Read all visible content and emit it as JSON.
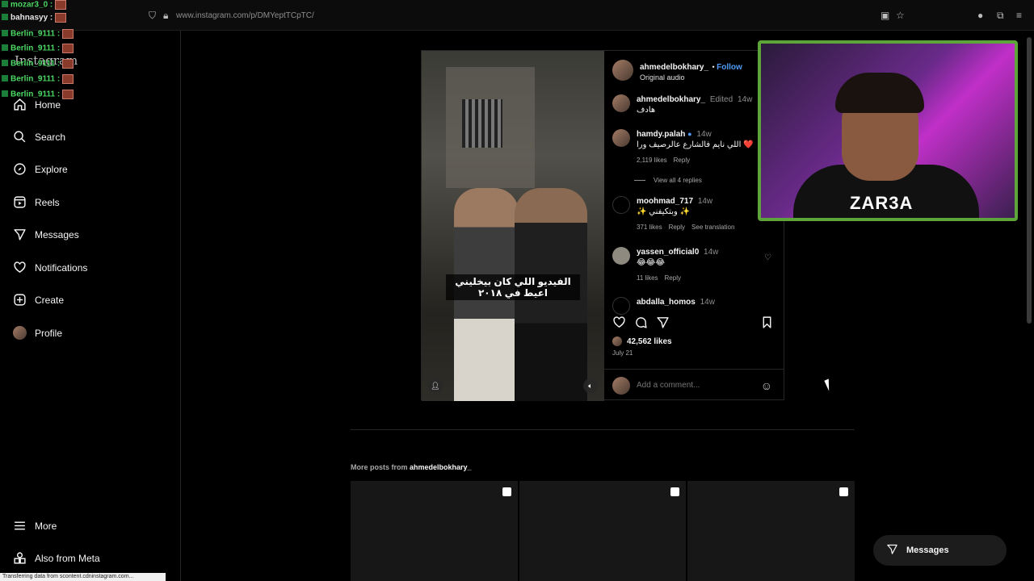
{
  "browser": {
    "url": "www.instagram.com/p/DMYeptTCpTC/"
  },
  "chat": [
    {
      "user": "mozar3_0 :"
    },
    {
      "user": "bahnasyy :"
    },
    {
      "user": "Berlin_9111 :"
    },
    {
      "user": "Berlin_9111 :"
    },
    {
      "user": "Berlin_9111 :"
    },
    {
      "user": "Berlin_9111 :"
    },
    {
      "user": "Berlin_9111 :"
    }
  ],
  "sidebar": {
    "logo": "Instagram",
    "items": [
      {
        "label": "Home",
        "icon": "home-icon"
      },
      {
        "label": "Search",
        "icon": "search-icon"
      },
      {
        "label": "Explore",
        "icon": "compass-icon"
      },
      {
        "label": "Reels",
        "icon": "reels-icon"
      },
      {
        "label": "Messages",
        "icon": "send-icon"
      },
      {
        "label": "Notifications",
        "icon": "heart-icon"
      },
      {
        "label": "Create",
        "icon": "plus-icon"
      },
      {
        "label": "Profile",
        "icon": "avatar"
      }
    ],
    "more": "More",
    "meta": "Also from Meta"
  },
  "status_bar": "Transferring data from scontent.cdninstagram.com...",
  "post": {
    "caption": "الفيديو اللي كان بيخليني اعيط في ٢٠١٨",
    "author": "ahmedelbokhary_",
    "follow": "Follow",
    "audio": "Original audio",
    "comments": [
      {
        "user": "ahmedelbokhary_",
        "badge": "Edited",
        "time": "14w",
        "text": "هادف"
      },
      {
        "user": "hamdy.palah",
        "time": "14w",
        "text": "❤️ اللي نايم فالشارع عالرصيف ورا",
        "likes": "2,119 likes",
        "reply": "Reply",
        "replies": "View all 4 replies"
      },
      {
        "user": "moohmad_717",
        "time": "14w",
        "text": "✨ وبتكيفني ✨",
        "likes": "371 likes",
        "reply": "Reply",
        "translate": "See translation"
      },
      {
        "user": "yassen_official0",
        "time": "14w",
        "text": "😂😂😂",
        "likes": "11 likes",
        "reply": "Reply"
      },
      {
        "user": "abdalla_homos",
        "time": "14w"
      }
    ],
    "likes": "42,562 likes",
    "date": "July 21",
    "comment_placeholder": "Add a comment..."
  },
  "more_posts": {
    "label": "More posts from",
    "user": "ahmedelbokhary_"
  },
  "webcam": {
    "logo": "ZAR3A"
  },
  "messages_button": "Messages"
}
